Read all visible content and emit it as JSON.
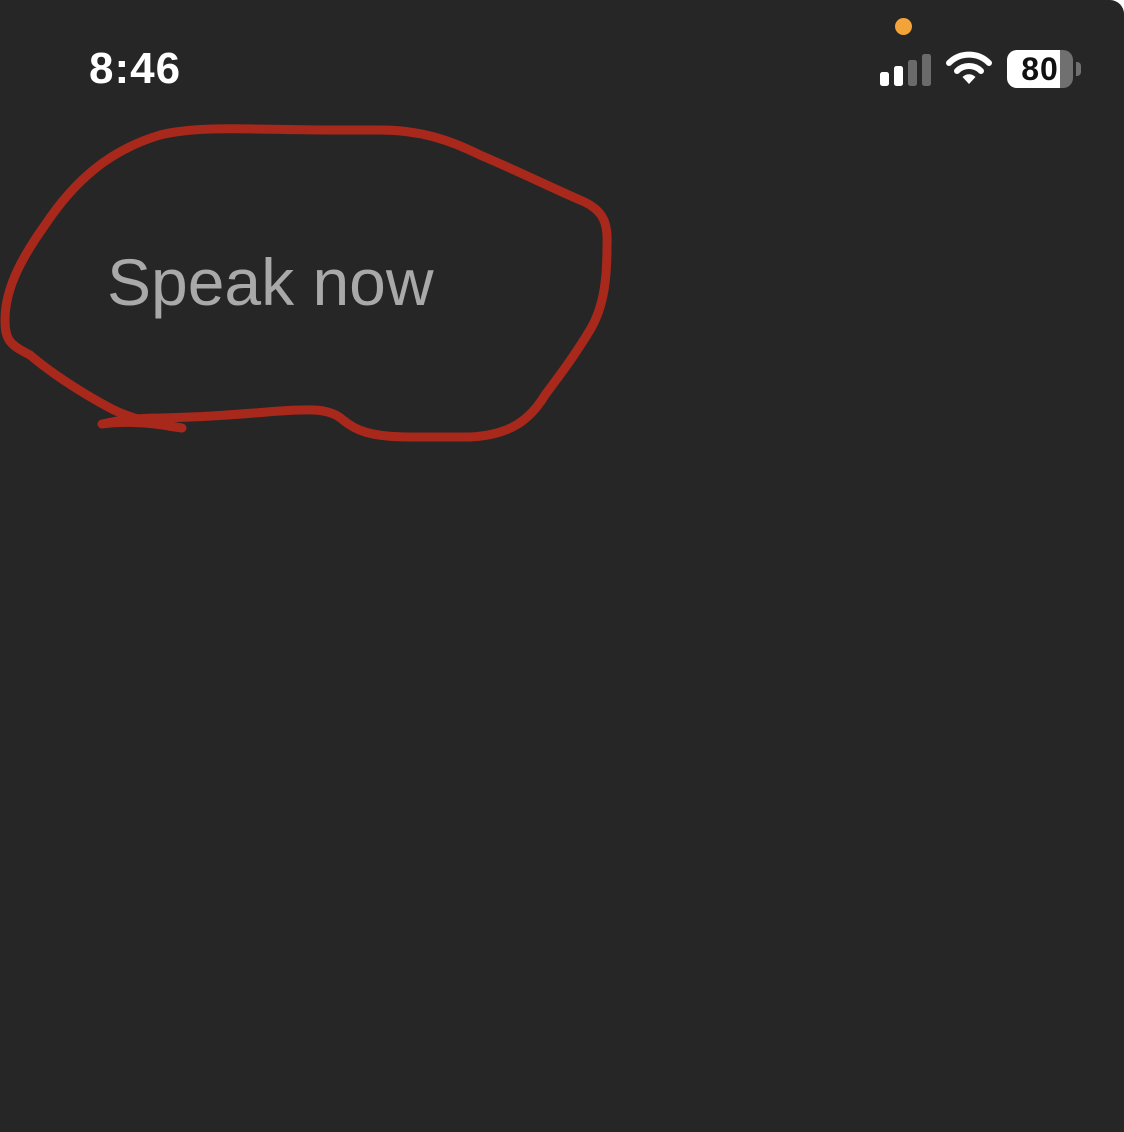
{
  "status_bar": {
    "time": "8:46",
    "battery_percent": "80",
    "battery_level": 0.8,
    "privacy_indicator_color": "#f2a33a",
    "signal_bars_active": 2,
    "signal_bars_total": 4,
    "icons": [
      "cellular-signal-icon",
      "wifi-icon",
      "battery-icon"
    ]
  },
  "main": {
    "prompt": "Speak now",
    "prompt_color": "#a9a9a9",
    "background_color": "#262626"
  },
  "annotation": {
    "type": "freehand-circle",
    "color": "#a8281c"
  }
}
